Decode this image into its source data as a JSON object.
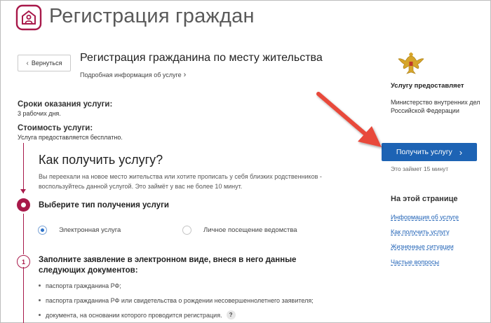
{
  "header": {
    "site_title": "Регистрация граждан",
    "logo_icon": "house-person-icon",
    "brand_color": "#a8194a"
  },
  "service": {
    "back_label": "Вернуться",
    "title": "Регистрация гражданина по месту жительства",
    "more_info": "Подробная информация об услуге",
    "term_heading": "Сроки оказания услуги:",
    "term_value": "3 рабочих дня.",
    "cost_heading": "Стоимость услуги:",
    "cost_value": "Услуга предоставляется бесплатно."
  },
  "how": {
    "title": "Как получить услугу?",
    "description": "Вы переехали на новое место жительства или хотите прописать у себя близких родственников - воспользуйтесь данной услугой. Это займёт у вас не более 10 минут.",
    "step0_title": "Выберите тип получения услуги",
    "options": [
      {
        "label": "Электронная услуга",
        "selected": true
      },
      {
        "label": "Личное посещение ведомства",
        "selected": false
      }
    ],
    "step1_number": "1",
    "step1_title": "Заполните заявление в электронном виде, внеся в него данные следующих документов:",
    "documents": [
      "паспорта гражданина РФ;",
      "паспорта гражданина РФ или свидетельства о рождении несовершеннолетнего заявителя;",
      "документа, на основании которого проводится регистрация."
    ],
    "help_symbol": "?"
  },
  "sidebar": {
    "emblem_icon": "double-headed-eagle-emblem",
    "provider_label": "Услугу предоставляет",
    "provider_name": "Министерство внутренних дел Российской Федерации",
    "get_service_label": "Получить услугу",
    "takes_time": "Это займет 15 минут",
    "on_page_title": "На этой странице",
    "links": [
      "Информация об услуге",
      "Как получить услугу",
      "Жизненные ситуации",
      "Частые вопросы"
    ],
    "button_color": "#1d63b4"
  },
  "annotation": {
    "arrow_color": "#e8483a"
  }
}
